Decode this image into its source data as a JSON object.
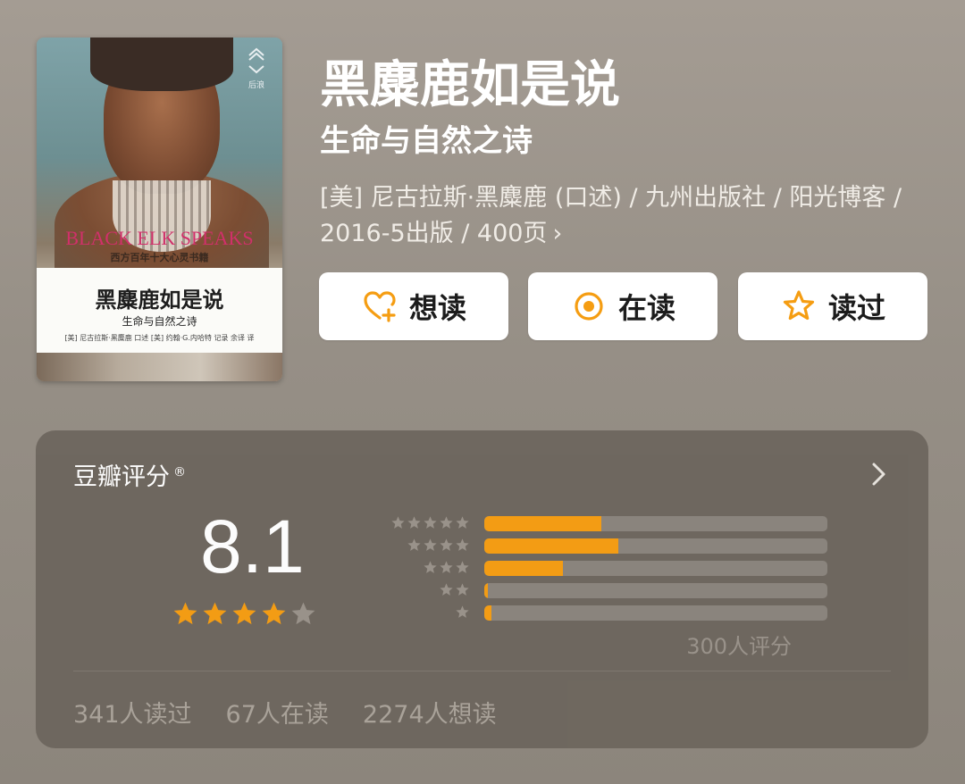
{
  "book": {
    "title": "黑麋鹿如是说",
    "subtitle": "生命与自然之诗",
    "meta": "[美] 尼古拉斯·黑麋鹿 (口述) / 九州出版社 / 阳光博客 / 2016-5出版 / 400页",
    "meta_chevron": "›"
  },
  "cover": {
    "english_title": "BLACK ELK SPEAKS",
    "english_sub": "西方百年十大心灵书籍",
    "cn_title": "黑麋鹿如是说",
    "cn_sub": "生命与自然之诗",
    "credit": "[美] 尼古拉斯·黑麋鹿 口述  [美] 约翰·G.内哈特 记录  余译 译",
    "badge": "后浪"
  },
  "actions": [
    {
      "label": "想读",
      "icon": "heart-plus-icon"
    },
    {
      "label": "在读",
      "icon": "target-circle-icon"
    },
    {
      "label": "读过",
      "icon": "star-outline-icon"
    }
  ],
  "rating": {
    "header": "豆瓣评分",
    "registered": "®",
    "score": "8.1",
    "stars": 4,
    "count_text": "300人评分",
    "distribution": [
      {
        "stars": 5,
        "fraction": 0.34
      },
      {
        "stars": 4,
        "fraction": 0.39
      },
      {
        "stars": 3,
        "fraction": 0.23
      },
      {
        "stars": 2,
        "fraction": 0.01
      },
      {
        "stars": 1,
        "fraction": 0.02
      }
    ]
  },
  "stats": {
    "read": "341人读过",
    "reading": "67人在读",
    "want": "2274人想读"
  },
  "colors": {
    "accent": "#f59d12",
    "star_gray": "#9a938b"
  }
}
